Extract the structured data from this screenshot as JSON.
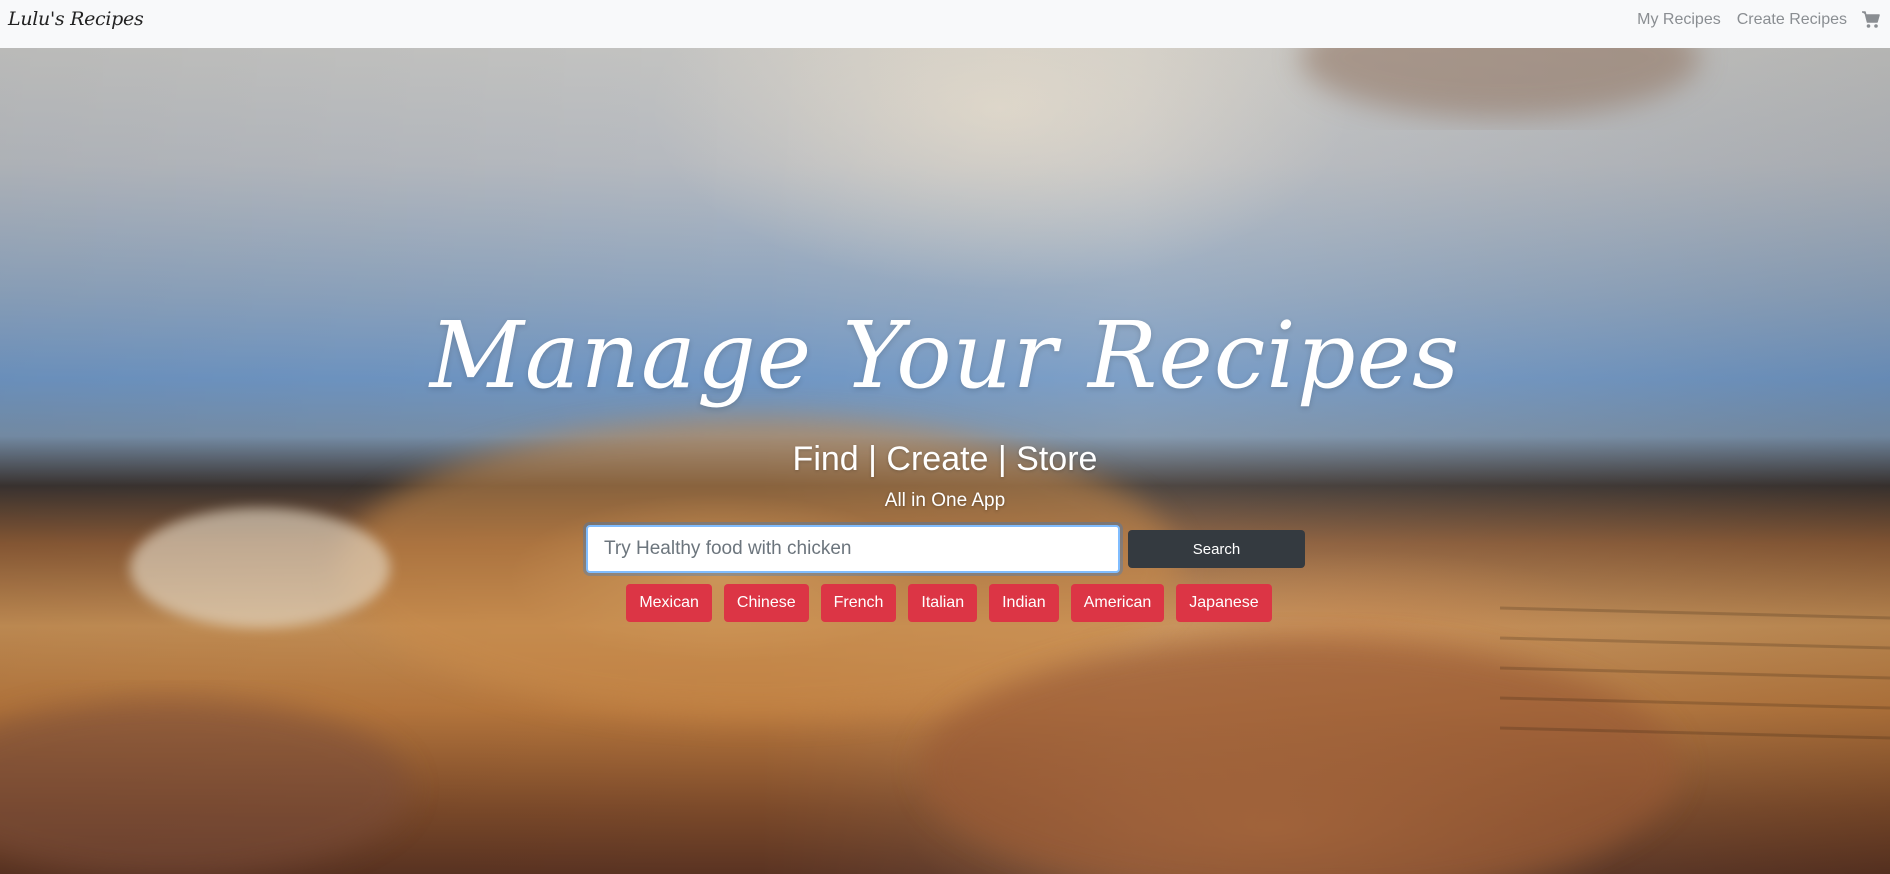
{
  "navbar": {
    "brand": "Lulu's Recipes",
    "links": [
      "My Recipes",
      "Create Recipes"
    ],
    "cart_icon": "shopping-cart-icon"
  },
  "hero": {
    "title": "Manage Your Recipes",
    "subtitle": "Find | Create | Store",
    "tagline": "All in One App",
    "search": {
      "placeholder": "Try Healthy food with chicken",
      "value": "",
      "button_label": "Search"
    },
    "cuisines": [
      "Mexican",
      "Chinese",
      "French",
      "Italian",
      "Indian",
      "American",
      "Japanese"
    ]
  },
  "colors": {
    "navbar_bg": "#f8f9fa",
    "search_button": "#343a40",
    "cuisine_button": "#dc3545",
    "nav_link": "#8a8e92"
  }
}
